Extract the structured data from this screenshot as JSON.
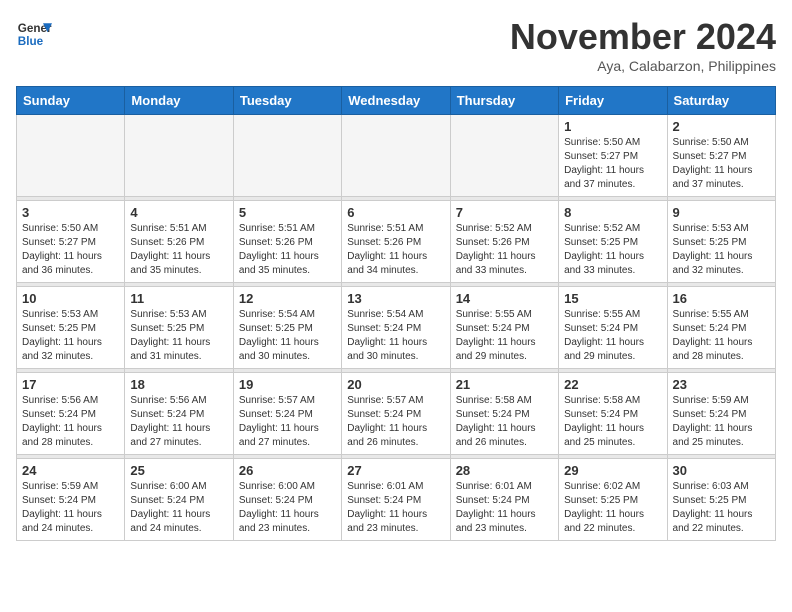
{
  "header": {
    "logo_line1": "General",
    "logo_line2": "Blue",
    "month": "November 2024",
    "location": "Aya, Calabarzon, Philippines"
  },
  "weekdays": [
    "Sunday",
    "Monday",
    "Tuesday",
    "Wednesday",
    "Thursday",
    "Friday",
    "Saturday"
  ],
  "weeks": [
    [
      {
        "day": "",
        "info": ""
      },
      {
        "day": "",
        "info": ""
      },
      {
        "day": "",
        "info": ""
      },
      {
        "day": "",
        "info": ""
      },
      {
        "day": "",
        "info": ""
      },
      {
        "day": "1",
        "info": "Sunrise: 5:50 AM\nSunset: 5:27 PM\nDaylight: 11 hours\nand 37 minutes."
      },
      {
        "day": "2",
        "info": "Sunrise: 5:50 AM\nSunset: 5:27 PM\nDaylight: 11 hours\nand 37 minutes."
      }
    ],
    [
      {
        "day": "3",
        "info": "Sunrise: 5:50 AM\nSunset: 5:27 PM\nDaylight: 11 hours\nand 36 minutes."
      },
      {
        "day": "4",
        "info": "Sunrise: 5:51 AM\nSunset: 5:26 PM\nDaylight: 11 hours\nand 35 minutes."
      },
      {
        "day": "5",
        "info": "Sunrise: 5:51 AM\nSunset: 5:26 PM\nDaylight: 11 hours\nand 35 minutes."
      },
      {
        "day": "6",
        "info": "Sunrise: 5:51 AM\nSunset: 5:26 PM\nDaylight: 11 hours\nand 34 minutes."
      },
      {
        "day": "7",
        "info": "Sunrise: 5:52 AM\nSunset: 5:26 PM\nDaylight: 11 hours\nand 33 minutes."
      },
      {
        "day": "8",
        "info": "Sunrise: 5:52 AM\nSunset: 5:25 PM\nDaylight: 11 hours\nand 33 minutes."
      },
      {
        "day": "9",
        "info": "Sunrise: 5:53 AM\nSunset: 5:25 PM\nDaylight: 11 hours\nand 32 minutes."
      }
    ],
    [
      {
        "day": "10",
        "info": "Sunrise: 5:53 AM\nSunset: 5:25 PM\nDaylight: 11 hours\nand 32 minutes."
      },
      {
        "day": "11",
        "info": "Sunrise: 5:53 AM\nSunset: 5:25 PM\nDaylight: 11 hours\nand 31 minutes."
      },
      {
        "day": "12",
        "info": "Sunrise: 5:54 AM\nSunset: 5:25 PM\nDaylight: 11 hours\nand 30 minutes."
      },
      {
        "day": "13",
        "info": "Sunrise: 5:54 AM\nSunset: 5:24 PM\nDaylight: 11 hours\nand 30 minutes."
      },
      {
        "day": "14",
        "info": "Sunrise: 5:55 AM\nSunset: 5:24 PM\nDaylight: 11 hours\nand 29 minutes."
      },
      {
        "day": "15",
        "info": "Sunrise: 5:55 AM\nSunset: 5:24 PM\nDaylight: 11 hours\nand 29 minutes."
      },
      {
        "day": "16",
        "info": "Sunrise: 5:55 AM\nSunset: 5:24 PM\nDaylight: 11 hours\nand 28 minutes."
      }
    ],
    [
      {
        "day": "17",
        "info": "Sunrise: 5:56 AM\nSunset: 5:24 PM\nDaylight: 11 hours\nand 28 minutes."
      },
      {
        "day": "18",
        "info": "Sunrise: 5:56 AM\nSunset: 5:24 PM\nDaylight: 11 hours\nand 27 minutes."
      },
      {
        "day": "19",
        "info": "Sunrise: 5:57 AM\nSunset: 5:24 PM\nDaylight: 11 hours\nand 27 minutes."
      },
      {
        "day": "20",
        "info": "Sunrise: 5:57 AM\nSunset: 5:24 PM\nDaylight: 11 hours\nand 26 minutes."
      },
      {
        "day": "21",
        "info": "Sunrise: 5:58 AM\nSunset: 5:24 PM\nDaylight: 11 hours\nand 26 minutes."
      },
      {
        "day": "22",
        "info": "Sunrise: 5:58 AM\nSunset: 5:24 PM\nDaylight: 11 hours\nand 25 minutes."
      },
      {
        "day": "23",
        "info": "Sunrise: 5:59 AM\nSunset: 5:24 PM\nDaylight: 11 hours\nand 25 minutes."
      }
    ],
    [
      {
        "day": "24",
        "info": "Sunrise: 5:59 AM\nSunset: 5:24 PM\nDaylight: 11 hours\nand 24 minutes."
      },
      {
        "day": "25",
        "info": "Sunrise: 6:00 AM\nSunset: 5:24 PM\nDaylight: 11 hours\nand 24 minutes."
      },
      {
        "day": "26",
        "info": "Sunrise: 6:00 AM\nSunset: 5:24 PM\nDaylight: 11 hours\nand 23 minutes."
      },
      {
        "day": "27",
        "info": "Sunrise: 6:01 AM\nSunset: 5:24 PM\nDaylight: 11 hours\nand 23 minutes."
      },
      {
        "day": "28",
        "info": "Sunrise: 6:01 AM\nSunset: 5:24 PM\nDaylight: 11 hours\nand 23 minutes."
      },
      {
        "day": "29",
        "info": "Sunrise: 6:02 AM\nSunset: 5:25 PM\nDaylight: 11 hours\nand 22 minutes."
      },
      {
        "day": "30",
        "info": "Sunrise: 6:03 AM\nSunset: 5:25 PM\nDaylight: 11 hours\nand 22 minutes."
      }
    ]
  ]
}
